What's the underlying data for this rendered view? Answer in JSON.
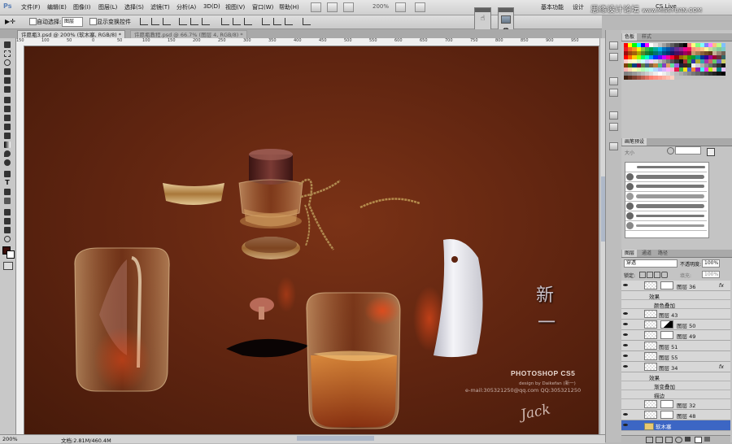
{
  "app": {
    "logo": "Ps",
    "zoom": "200%"
  },
  "menu": [
    "文件(F)",
    "编辑(E)",
    "图像(I)",
    "图层(L)",
    "选择(S)",
    "滤镜(T)",
    "分析(A)",
    "3D(D)",
    "视图(V)",
    "窗口(W)",
    "帮助(H)"
  ],
  "workspace": {
    "basic": "基本功能",
    "design": "设计",
    "cs_live": "CS Live"
  },
  "watermark": {
    "text": "思缘设计论坛",
    "url": "www.MISSYUAN.COM"
  },
  "options": {
    "auto_select": "自动选择:",
    "auto_select_value": "图层",
    "show_transform": "显示变换控件"
  },
  "tabs": [
    {
      "label": "许愿瓶3.psd @ 200% (软木塞, RGB/8) *",
      "active": true
    },
    {
      "label": "许愿瓶教程.psd @ 66.7% (图层 4, RGB/8) *",
      "active": false
    }
  ],
  "ruler": {
    "ticks": [
      "150",
      "100",
      "50",
      "0",
      "50",
      "100",
      "150",
      "200",
      "250",
      "300",
      "350",
      "400",
      "450",
      "500",
      "550",
      "600",
      "650",
      "700",
      "750",
      "800",
      "850",
      "900",
      "950"
    ]
  },
  "canvas": {
    "brand": "PHOTOSHOP CS5",
    "design_by": "design by Daikefan (新一)",
    "contact": "e-mail:305321250@qq.com  QQ:305321250",
    "signature": "Jack",
    "calligraphy": [
      "新",
      "一"
    ]
  },
  "status": {
    "zoom": "200%",
    "doc": "文档:2.81M/460.4M"
  },
  "panels": {
    "color_tabs": [
      "色板",
      "样式"
    ],
    "brush_tabs": [
      "画笔预设"
    ],
    "brush_size_label": "大小",
    "layers_tabs": [
      "图层",
      "通道",
      "路径"
    ],
    "blend_mode": "穿透",
    "opacity_label": "不透明度:",
    "opacity_value": "100%",
    "lock_label": "锁定:",
    "fill_label": "填充:",
    "fill_value": "100%"
  },
  "layers": [
    {
      "kind": "layer",
      "name": "图层 36",
      "fx": "fx",
      "mask": "white",
      "eye": true
    },
    {
      "kind": "effect",
      "name": "效果"
    },
    {
      "kind": "effect",
      "name": "颜色叠加"
    },
    {
      "kind": "layer",
      "name": "图层 43",
      "eye": true
    },
    {
      "kind": "layer",
      "name": "图层 50",
      "mask": "half",
      "eye": true
    },
    {
      "kind": "layer",
      "name": "图层 49",
      "mask": "white",
      "eye": true
    },
    {
      "kind": "layer",
      "name": "图层 51",
      "eye": true
    },
    {
      "kind": "layer",
      "name": "图层 55",
      "eye": true
    },
    {
      "kind": "layer",
      "name": "图层 34",
      "fx": "fx",
      "eye": true
    },
    {
      "kind": "effect",
      "name": "效果"
    },
    {
      "kind": "effect",
      "name": "渐变叠加"
    },
    {
      "kind": "effect",
      "name": "描边"
    },
    {
      "kind": "layer",
      "name": "图层 32",
      "mask": "white",
      "eye": false
    },
    {
      "kind": "layer",
      "name": "图层 48",
      "mask": "white",
      "eye": true
    },
    {
      "kind": "group",
      "name": "软木塞",
      "selected": true,
      "eye": true
    }
  ],
  "colors": {
    "canvas": "#5e2410",
    "selection": "#3c66c4",
    "glass": "#d8a060",
    "cork": "#5a2220"
  }
}
